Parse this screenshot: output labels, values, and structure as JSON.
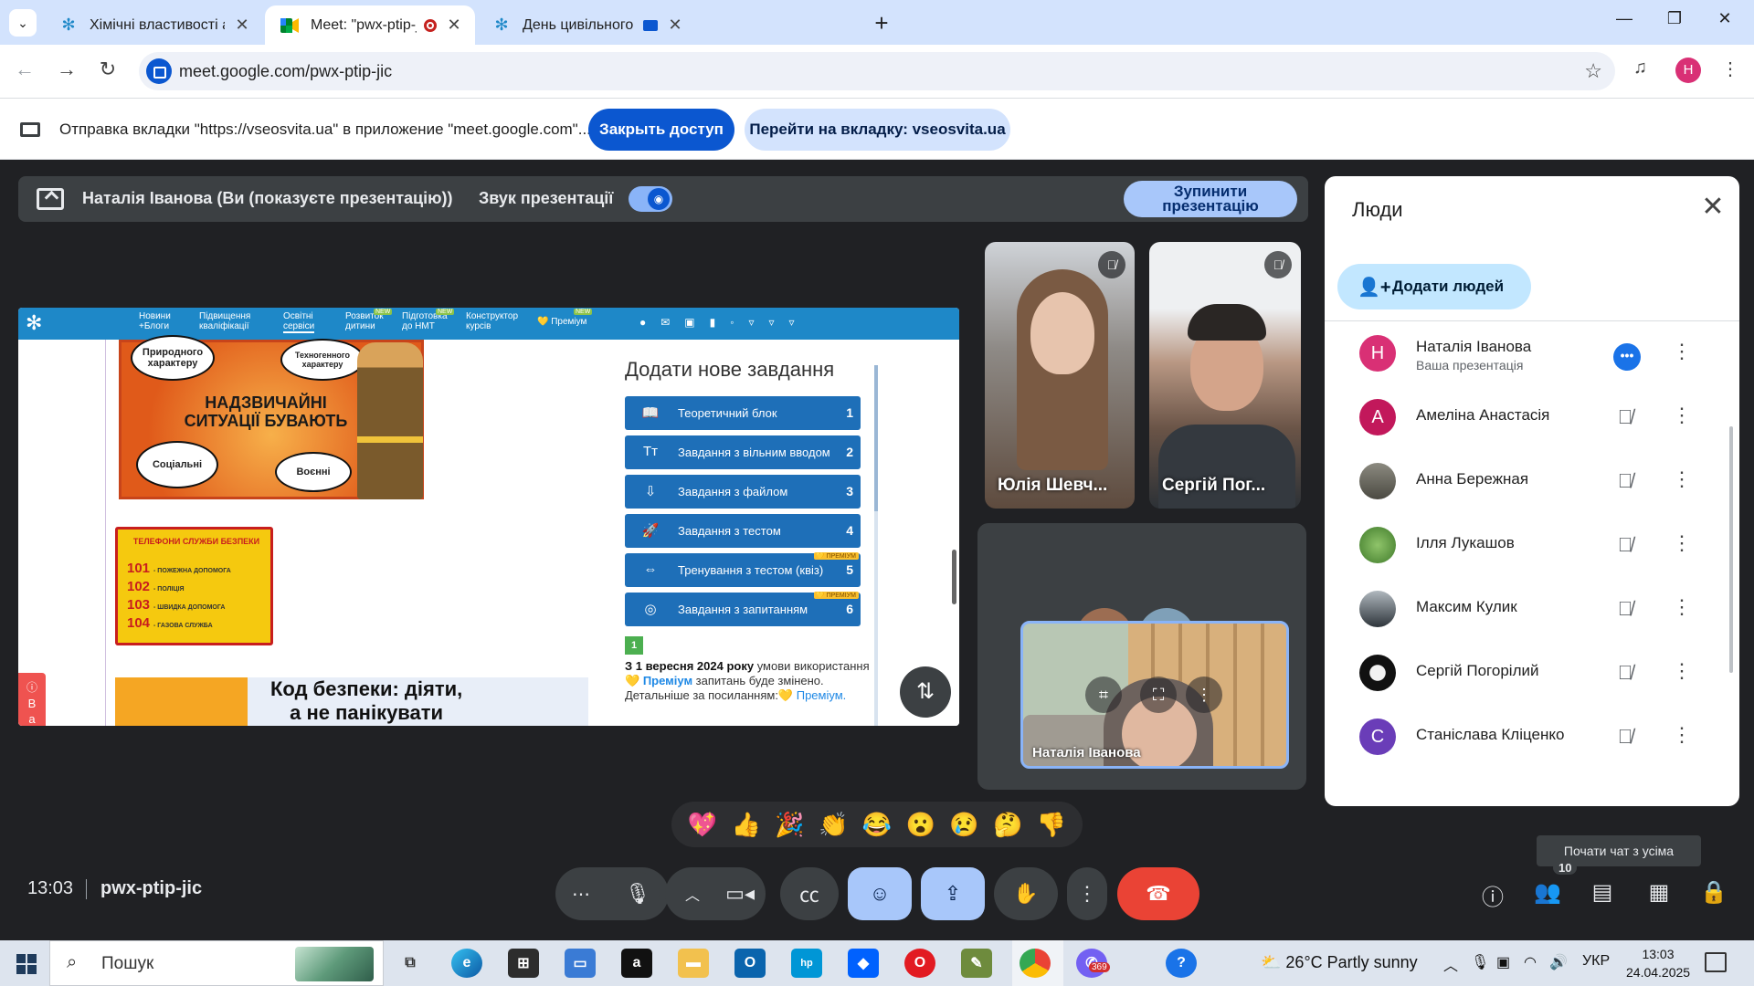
{
  "browser": {
    "tabs": [
      {
        "title": "Хімічні властивості аміноетано",
        "active": false
      },
      {
        "title": "Meet: \"pwx-ptip-jic\"",
        "active": true
      },
      {
        "title": "День цивільного захисту |",
        "active": false
      }
    ],
    "url": "meet.google.com/pwx-ptip-jic",
    "profile_initial": "Н"
  },
  "infobar": {
    "text": "Отправка вкладки \"https://vseosvita.ua\" в приложение \"meet.google.com\"...",
    "close_access": "Закрыть доступ",
    "go_to_tab": "Перейти на вкладку: vseosvita.ua"
  },
  "present_bar": {
    "presenter": "Наталія Іванова (Ви (показуєте презентацію))",
    "audio_label": "Звук презентації",
    "stop_label_1": "Зупинити",
    "stop_label_2": "презентацію"
  },
  "shared_page": {
    "nav": [
      {
        "l1": "Новини",
        "l2": "+Блоги",
        "badge": ""
      },
      {
        "l1": "Підвищення",
        "l2": "кваліфікації",
        "badge": ""
      },
      {
        "l1": "Освітні",
        "l2": "сервіси",
        "badge": ""
      },
      {
        "l1": "Розвиток",
        "l2": "дитини",
        "badge": "NEW"
      },
      {
        "l1": "Підготовка",
        "l2": "до НМТ",
        "badge": "NEW"
      },
      {
        "l1": "Конструктор",
        "l2": "курсів",
        "badge": ""
      },
      {
        "l1": "💛 Преміум",
        "l2": "",
        "badge": "NEW"
      }
    ],
    "comic": {
      "bubble1": "Природного характеру",
      "bubble2": "Техногенного характеру",
      "bubble3": "Соціальні",
      "bubble4": "Воєнні",
      "title": "НАДЗВИЧАЙНІ СИТУАЦІЇ БУВАЮТЬ"
    },
    "phones": {
      "title": "ТЕЛЕФОНИ СЛУЖБИ БЕЗПЕКИ",
      "lines": [
        {
          "num": "101",
          "desc": "- ПОЖЕЖНА ДОПОМОГА"
        },
        {
          "num": "102",
          "desc": "- ПОЛІЦІЯ"
        },
        {
          "num": "103",
          "desc": "- ШВИДКА ДОПОМОГА"
        },
        {
          "num": "104",
          "desc": "- ГАЗОВА СЛУЖБА"
        }
      ]
    },
    "safety_banner_1": "Код безпеки: діяти,",
    "safety_banner_2": "а не панікувати",
    "important_tab": "Важливо",
    "task_panel": {
      "heading": "Додати нове завдання",
      "buttons": [
        {
          "icon": "📖",
          "label": "Теоретичний блок",
          "num": "1",
          "premium": ""
        },
        {
          "icon": "Tт",
          "label": "Завдання з вільним вводом",
          "num": "2",
          "premium": ""
        },
        {
          "icon": "⇩",
          "label": "Завдання з файлом",
          "num": "3",
          "premium": ""
        },
        {
          "icon": "🚀",
          "label": "Завдання з тестом",
          "num": "4",
          "premium": ""
        },
        {
          "icon": "⇔",
          "label": "Тренування з тестом (квіз)",
          "num": "5",
          "premium": "💛 ПРЕМІУМ"
        },
        {
          "icon": "◎",
          "label": "Завдання з запитанням",
          "num": "6",
          "premium": "💛 ПРЕМІУМ"
        }
      ],
      "step": "1",
      "note_bold": "З 1 вересня 2024 року",
      "note_1": " умови використання 💛 ",
      "note_premium": "Преміум",
      "note_2": " запитань буде змінено. Детальніше за посиланням:💛 ",
      "note_premium_link": "Преміум."
    }
  },
  "tiles": {
    "julia": "Юлія Шевч...",
    "serhii": "Сергій Пог...",
    "self": "Наталія Іванова"
  },
  "people": {
    "title": "Люди",
    "add": "Додати людей",
    "list": [
      {
        "name": "Наталія Іванова",
        "sub": "Ваша презентація",
        "initial": "Н",
        "color": "#d93075"
      },
      {
        "name": "Амеліна Анастасія",
        "sub": "",
        "initial": "А",
        "color": "#c2185b"
      },
      {
        "name": "Анна Бережная",
        "sub": "",
        "initial": "",
        "color": "#6d6a5e"
      },
      {
        "name": "Ілля Лукашов",
        "sub": "",
        "initial": "",
        "color": "#6ea84a"
      },
      {
        "name": "Максим Кулик",
        "sub": "",
        "initial": "",
        "color": "#4e5a63"
      },
      {
        "name": "Сергій Погорілий",
        "sub": "",
        "initial": "",
        "color": "#1a1a1a"
      },
      {
        "name": "Станіслава Кліценко",
        "sub": "",
        "initial": "С",
        "color": "#6a3db8"
      }
    ]
  },
  "reactions": [
    "💖",
    "👍",
    "🎉",
    "👏",
    "😂",
    "😮",
    "😢",
    "🤔",
    "👎"
  ],
  "controls": {
    "clock": "13:03",
    "meeting_code": "pwx-ptip-jic",
    "tooltip": "Почати чат з усіма",
    "people_count": "10"
  },
  "taskbar": {
    "search": "Пошук",
    "weather": "26°C  Partly sunny",
    "lang": "УКР",
    "time": "13:03",
    "date": "24.04.2025",
    "viber_badge": "369"
  }
}
